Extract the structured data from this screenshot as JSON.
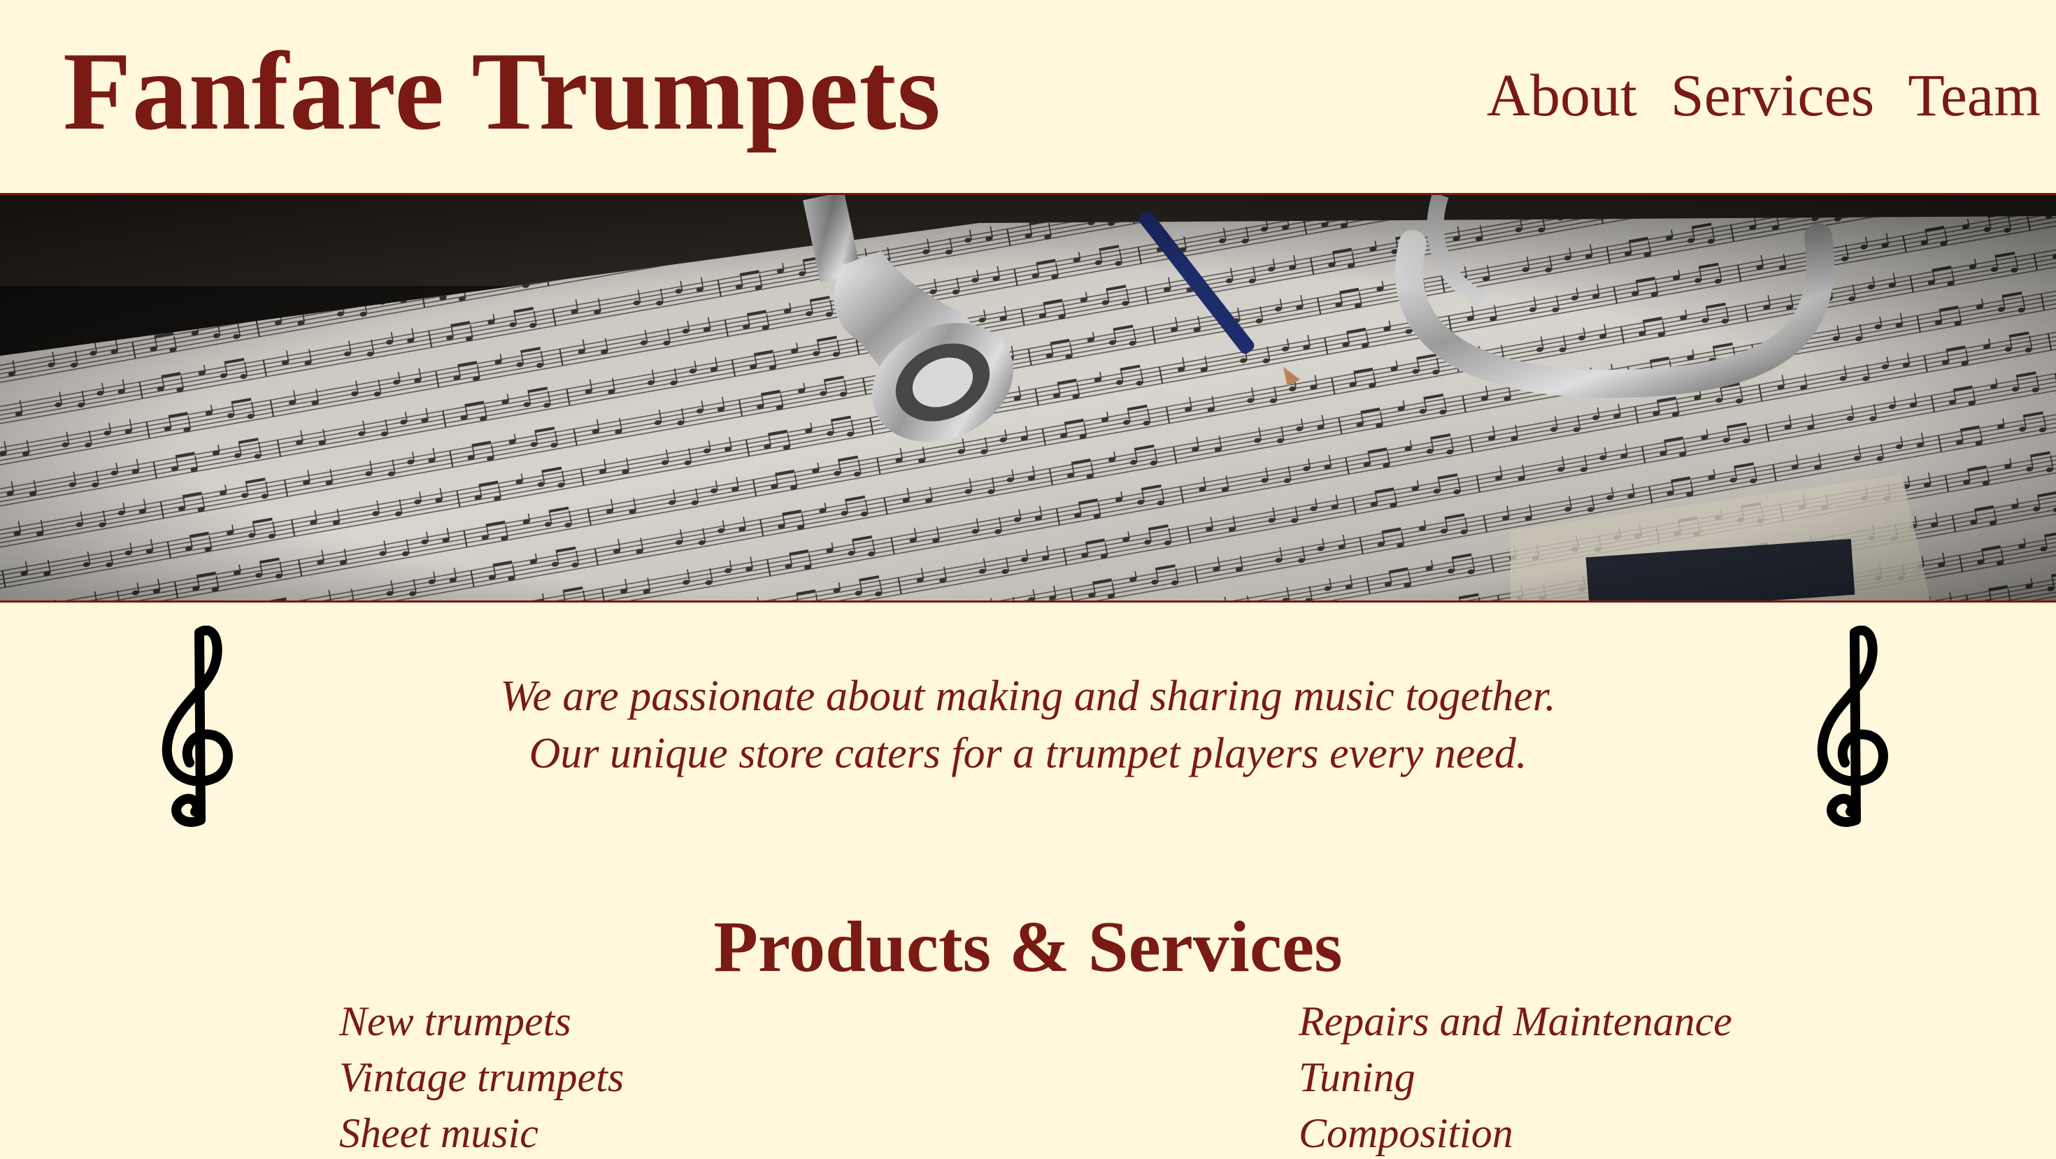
{
  "header": {
    "title": "Fanfare Trumpets",
    "nav": [
      "About",
      "Services",
      "Team"
    ]
  },
  "hero": {
    "image": "trumpet mouthpiece and pencil resting on sheet music"
  },
  "intro": {
    "line1": "We are passionate about making and sharing music together.",
    "line2": "Our unique store caters for a trumpet players every need."
  },
  "products": {
    "title": "Products & Services",
    "left_items": [
      "New trumpets",
      "Vintage trumpets",
      "Sheet music"
    ],
    "right_items": [
      "Repairs and Maintenance",
      "Tuning",
      "Composition"
    ]
  },
  "colors": {
    "background": "#fff8dc",
    "brand": "#7a1a14",
    "icon": "#000000"
  },
  "icons": {
    "decoration": "treble-clef-icon"
  }
}
